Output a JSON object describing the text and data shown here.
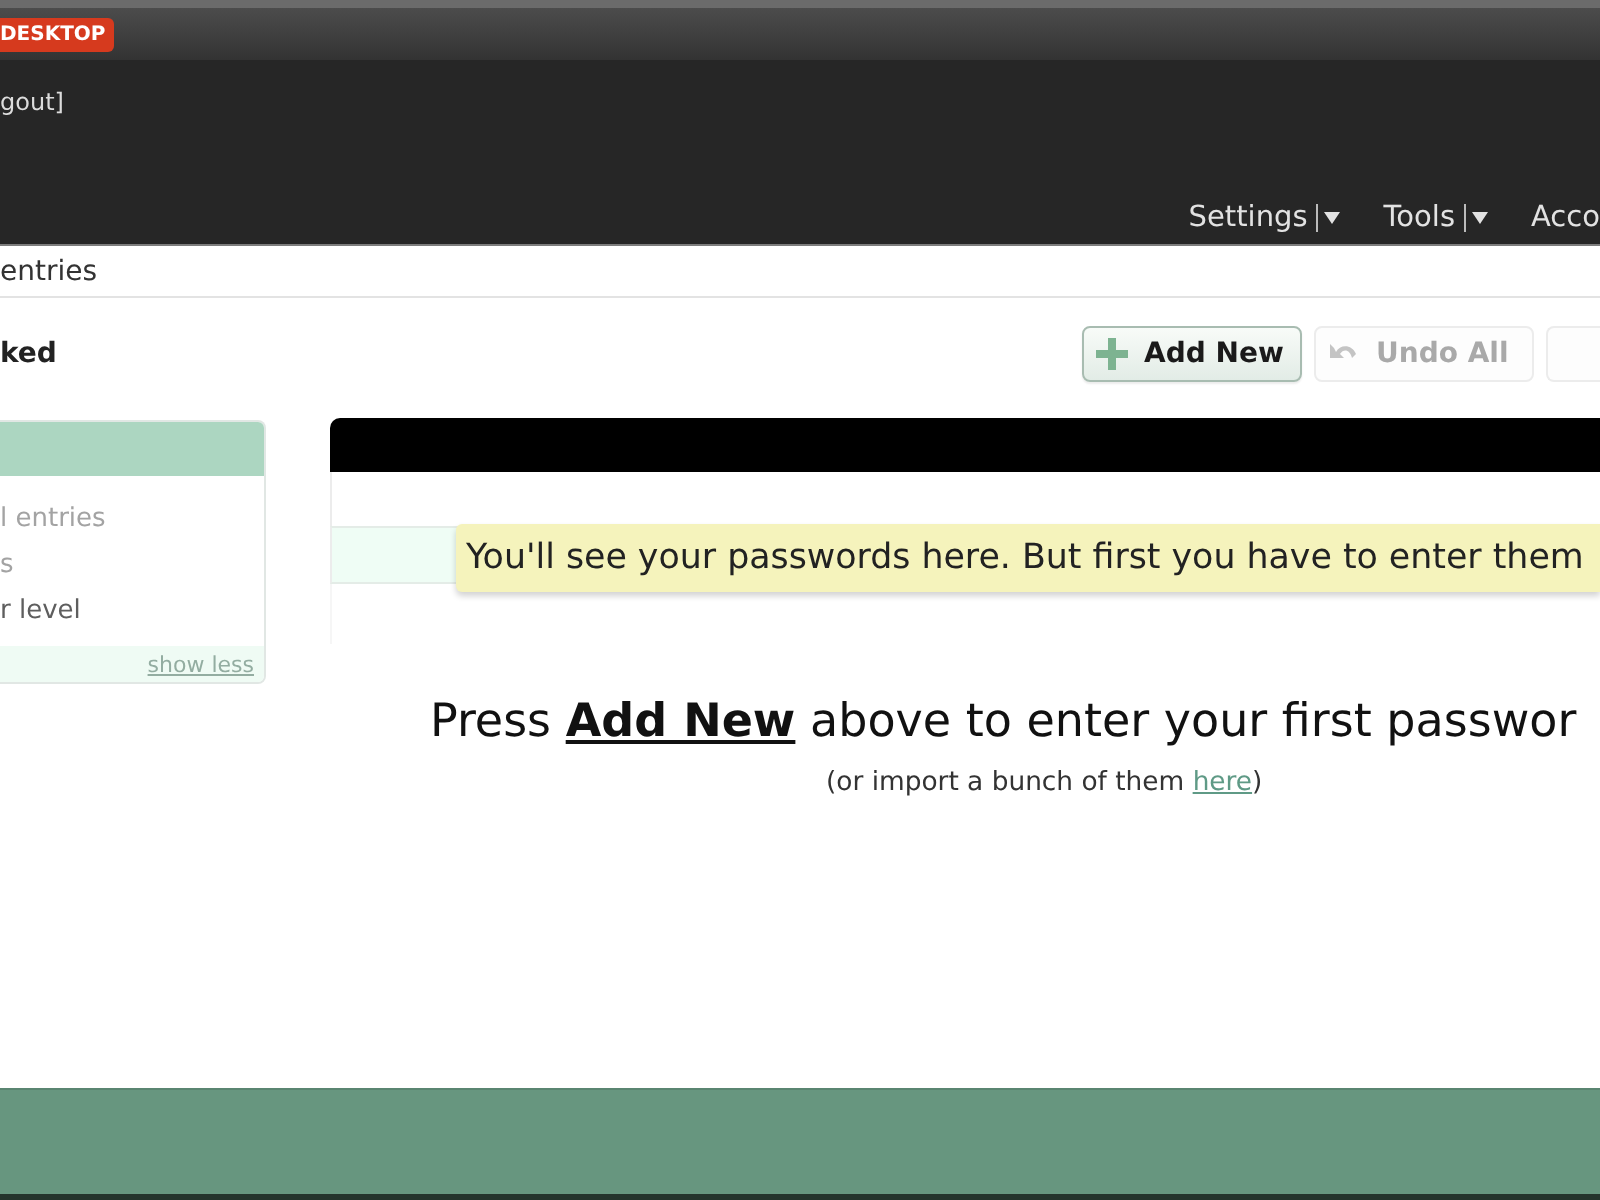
{
  "top_bar": {
    "logo": "DESKTOP"
  },
  "header": {
    "user_link": "gout]",
    "nav": [
      {
        "label": "Settings",
        "has_menu": true
      },
      {
        "label": "Tools",
        "has_menu": true
      },
      {
        "label": "Acco",
        "has_menu": false
      }
    ]
  },
  "breadcrumb": {
    "label": "entries"
  },
  "toolbar": {
    "title": "ked",
    "buttons": [
      {
        "kind": "add",
        "label": "Add New",
        "disabled": false
      },
      {
        "kind": "undo",
        "label": "Undo All",
        "disabled": true
      },
      {
        "kind": "blank",
        "disabled": true
      }
    ]
  },
  "sidebar": {
    "items": [
      {
        "label": "l entries",
        "disabled": true
      },
      {
        "label": "s",
        "disabled": true
      },
      {
        "label": "r level",
        "disabled": false
      }
    ],
    "toggle": "show less"
  },
  "main": {
    "tip": "You'll see your passwords here. But first you have to enter them",
    "empty_message": "Press **Add New** above to enter your first passwor",
    "import_hint": {
      "before": "(or import a bunch of them ",
      "link": "here",
      "after": ")"
    }
  }
}
